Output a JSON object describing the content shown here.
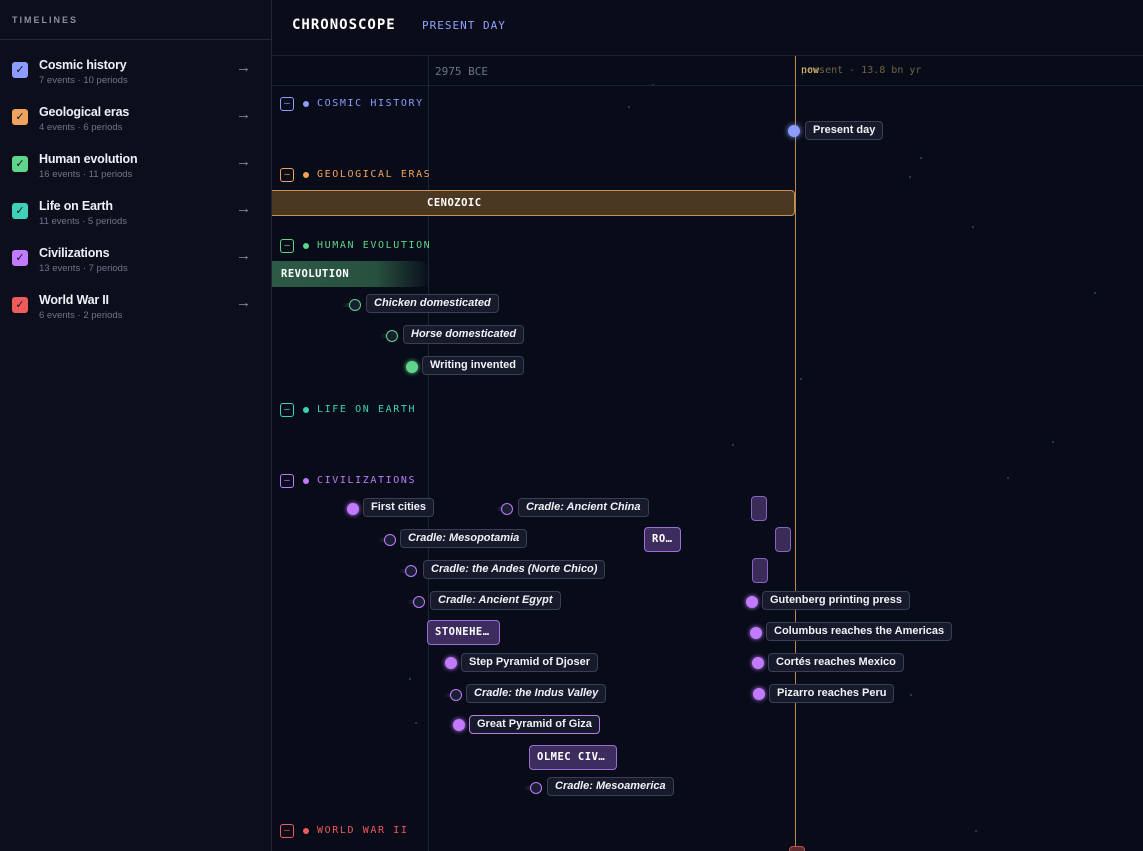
{
  "sidebar": {
    "title": "TIMELINES",
    "items": [
      {
        "name": "Cosmic history",
        "meta": "7 events · 10 periods",
        "color": "#8c9cff",
        "check": "✓",
        "arrow": "→"
      },
      {
        "name": "Geological eras",
        "meta": "4 events · 6 periods",
        "color": "#f0a35e",
        "check": "✓",
        "arrow": "→"
      },
      {
        "name": "Human evolution",
        "meta": "16 events · 11 periods",
        "color": "#5fd48a",
        "check": "✓",
        "arrow": "→"
      },
      {
        "name": "Life on Earth",
        "meta": "11 events · 5 periods",
        "color": "#3fd1b8",
        "check": "✓",
        "arrow": "→"
      },
      {
        "name": "Civilizations",
        "meta": "13 events · 7 periods",
        "color": "#c27bff",
        "check": "✓",
        "arrow": "→"
      },
      {
        "name": "World War II",
        "meta": "6 events · 2 periods",
        "color": "#ef5b5b",
        "check": "✓",
        "arrow": "→"
      }
    ]
  },
  "header": {
    "title": "CHRONOSCOPE",
    "subtitle": "PRESENT DAY"
  },
  "ruler": {
    "tick_label": "2975 BCE",
    "now_label": "now",
    "now_ghost": "present - 13.8 bn yr"
  },
  "tracks": {
    "cosmic": {
      "name": "COSMIC HISTORY",
      "color": "#8c9cff",
      "collapse": "–"
    },
    "geological": {
      "name": "GEOLOGICAL ERAS",
      "color": "#f0a35e",
      "collapse": "–"
    },
    "human": {
      "name": "HUMAN EVOLUTION",
      "color": "#5fd48a",
      "collapse": "–"
    },
    "life": {
      "name": "LIFE ON EARTH",
      "color": "#3fd1b8",
      "collapse": "–"
    },
    "civ": {
      "name": "CIVILIZATIONS",
      "color": "#c27bff",
      "collapse": "–"
    },
    "ww2": {
      "name": "WORLD WAR II",
      "color": "#ef5b5b",
      "collapse": "–"
    }
  },
  "periods": {
    "cenozoic": "CENOZOIC",
    "revolution": "REVOLUTION",
    "rome": "RO…",
    "stonehenge": "STONEHE…",
    "olmec": "OLMEC CIV…"
  },
  "events": {
    "present_day": "Present day",
    "chicken": "Chicken domesticated",
    "horse": "Horse domesticated",
    "writing": "Writing invented",
    "first_cities": "First cities",
    "cradle_china": "Cradle: Ancient China",
    "cradle_meso": "Cradle: Mesopotamia",
    "cradle_andes": "Cradle: the Andes (Norte Chico)",
    "cradle_egypt": "Cradle: Ancient Egypt",
    "step_pyramid": "Step Pyramid of Djoser",
    "cradle_indus": "Cradle: the Indus Valley",
    "great_pyramid": "Great Pyramid of Giza",
    "cradle_mesoamerica": "Cradle: Mesoamerica",
    "gutenberg": "Gutenberg printing press",
    "columbus": "Columbus reaches the Americas",
    "cortes": "Cortés reaches Mexico",
    "pizarro": "Pizarro reaches Peru"
  }
}
